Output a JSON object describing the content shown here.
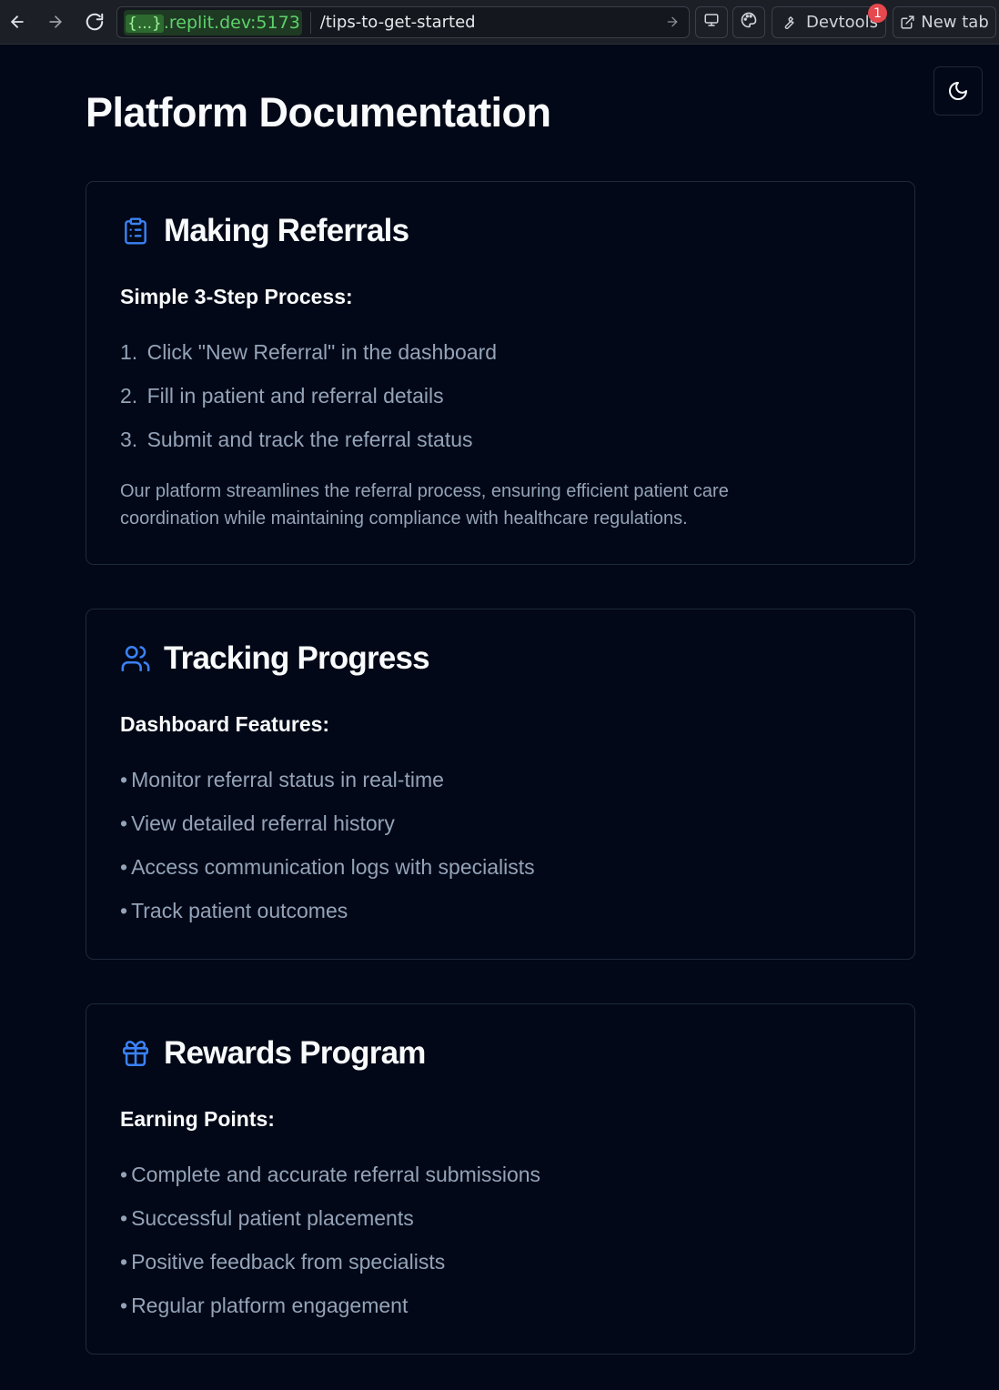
{
  "browser": {
    "url_host_braces": "{...}",
    "url_host": ".replit.dev:5173",
    "url_path": "/tips-to-get-started",
    "devtools_label": "Devtools",
    "devtools_badge": "1",
    "new_tab_label": "New tab"
  },
  "page": {
    "title": "Platform Documentation"
  },
  "sections": [
    {
      "icon": "clipboard-list-icon",
      "title": "Making Referrals",
      "subtitle": "Simple 3-Step Process:",
      "items": [
        {
          "mark": "1.",
          "text": "Click \"New Referral\" in the dashboard"
        },
        {
          "mark": "2.",
          "text": "Fill in patient and referral details"
        },
        {
          "mark": "3.",
          "text": "Submit and track the referral status"
        }
      ],
      "description": "Our platform streamlines the referral process, ensuring efficient patient care coordination while maintaining compliance with healthcare regulations."
    },
    {
      "icon": "users-icon",
      "title": "Tracking Progress",
      "subtitle": "Dashboard Features:",
      "items": [
        {
          "mark": "•",
          "text": "Monitor referral status in real-time"
        },
        {
          "mark": "•",
          "text": "View detailed referral history"
        },
        {
          "mark": "•",
          "text": "Access communication logs with specialists"
        },
        {
          "mark": "•",
          "text": "Track patient outcomes"
        }
      ]
    },
    {
      "icon": "gift-icon",
      "title": "Rewards Program",
      "subtitle": "Earning Points:",
      "items": [
        {
          "mark": "•",
          "text": "Complete and accurate referral submissions"
        },
        {
          "mark": "•",
          "text": "Successful patient placements"
        },
        {
          "mark": "•",
          "text": "Positive feedback from specialists"
        },
        {
          "mark": "•",
          "text": "Regular platform engagement"
        }
      ]
    }
  ],
  "colors": {
    "background": "#020817",
    "accent": "#3b82f6",
    "muted_text": "#94a3b8",
    "border": "#1e293b"
  }
}
